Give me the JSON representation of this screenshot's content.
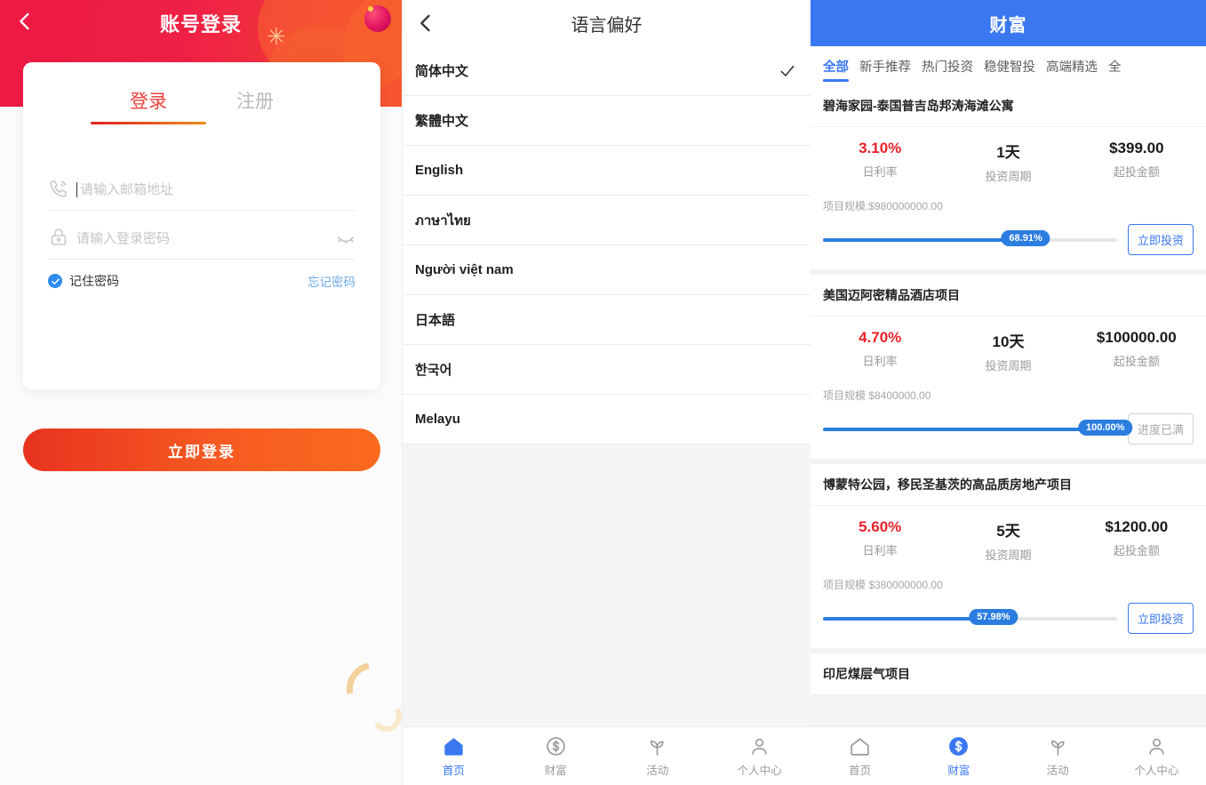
{
  "login": {
    "header_title": "账号登录",
    "back_icon": "chevron-left-icon",
    "tabs": [
      {
        "label": "登录",
        "active": true
      },
      {
        "label": "注册",
        "active": false
      }
    ],
    "email_field": {
      "icon": "phone-icon",
      "placeholder": "请输入邮箱地址",
      "value": ""
    },
    "password_field": {
      "icon": "lock-icon",
      "placeholder": "请输入登录密码",
      "value": "",
      "toggle_icon": "eye-closed-icon"
    },
    "remember": {
      "label": "记住密码",
      "checked": true,
      "icon": "check-circle-icon"
    },
    "forgot_label": "忘记密码",
    "submit_label": "立即登录",
    "colors": {
      "header_red": "#ed1a43",
      "accent_orange": "#f75a21",
      "link_blue": "#6aa8e8",
      "check_blue": "#2d8cf0"
    }
  },
  "language": {
    "header_title": "语言偏好",
    "back_icon": "chevron-left-icon",
    "selected_icon": "check-icon",
    "items": [
      {
        "label": "简体中文",
        "selected": true
      },
      {
        "label": "繁體中文",
        "selected": false
      },
      {
        "label": "English",
        "selected": false
      },
      {
        "label": "ภาษาไทย",
        "selected": false
      },
      {
        "label": "Người việt nam",
        "selected": false
      },
      {
        "label": "日本語",
        "selected": false
      },
      {
        "label": "한국어",
        "selected": false
      },
      {
        "label": "Melayu",
        "selected": false
      }
    ],
    "tabbar": [
      {
        "label": "首页",
        "icon": "home-icon",
        "active": true
      },
      {
        "label": "财富",
        "icon": "dollar-circle-icon",
        "active": false
      },
      {
        "label": "活动",
        "icon": "sprout-icon",
        "active": false
      },
      {
        "label": "个人中心",
        "icon": "person-icon",
        "active": false
      }
    ]
  },
  "wealth": {
    "header_title": "财富",
    "header_color": "#3a78f2",
    "tabs": [
      {
        "label": "全部",
        "active": true
      },
      {
        "label": "新手推荐",
        "active": false
      },
      {
        "label": "热门投资",
        "active": false
      },
      {
        "label": "稳健智投",
        "active": false
      },
      {
        "label": "高端精选",
        "active": false
      },
      {
        "label": "全",
        "active": false
      }
    ],
    "stat_labels": {
      "rate": "日利率",
      "period": "投资周期",
      "minimum": "起投金额"
    },
    "products": [
      {
        "title": "碧海家园-泰国普吉岛邦涛海滩公寓",
        "rate": "3.10%",
        "period": "1天",
        "minimum": "$399.00",
        "scale": "项目规模:$980000000.00",
        "progress": "68.91%",
        "progress_value": 68.91,
        "action": "立即投资",
        "action_disabled": false
      },
      {
        "title": "美国迈阿密精品酒店项目",
        "rate": "4.70%",
        "period": "10天",
        "minimum": "$100000.00",
        "scale": "项目规模 $8400000.00",
        "progress": "100.00%",
        "progress_value": 100,
        "action": "进度已满",
        "action_disabled": true
      },
      {
        "title": "博蒙特公园，移民圣基茨的高品质房地产项目",
        "rate": "5.60%",
        "period": "5天",
        "minimum": "$1200.00",
        "scale": "项目规模 $380000000.00",
        "progress": "57.98%",
        "progress_value": 57.98,
        "action": "立即投资",
        "action_disabled": false
      },
      {
        "title": "印尼煤层气项目",
        "rate": "",
        "period": "",
        "minimum": "",
        "scale": "",
        "progress": "",
        "progress_value": 0,
        "action": "",
        "action_disabled": false
      }
    ],
    "tabbar": [
      {
        "label": "首页",
        "icon": "home-icon",
        "active": false
      },
      {
        "label": "财富",
        "icon": "dollar-circle-filled-icon",
        "active": true
      },
      {
        "label": "活动",
        "icon": "sprout-icon",
        "active": false
      },
      {
        "label": "个人中心",
        "icon": "person-icon",
        "active": false
      }
    ]
  }
}
